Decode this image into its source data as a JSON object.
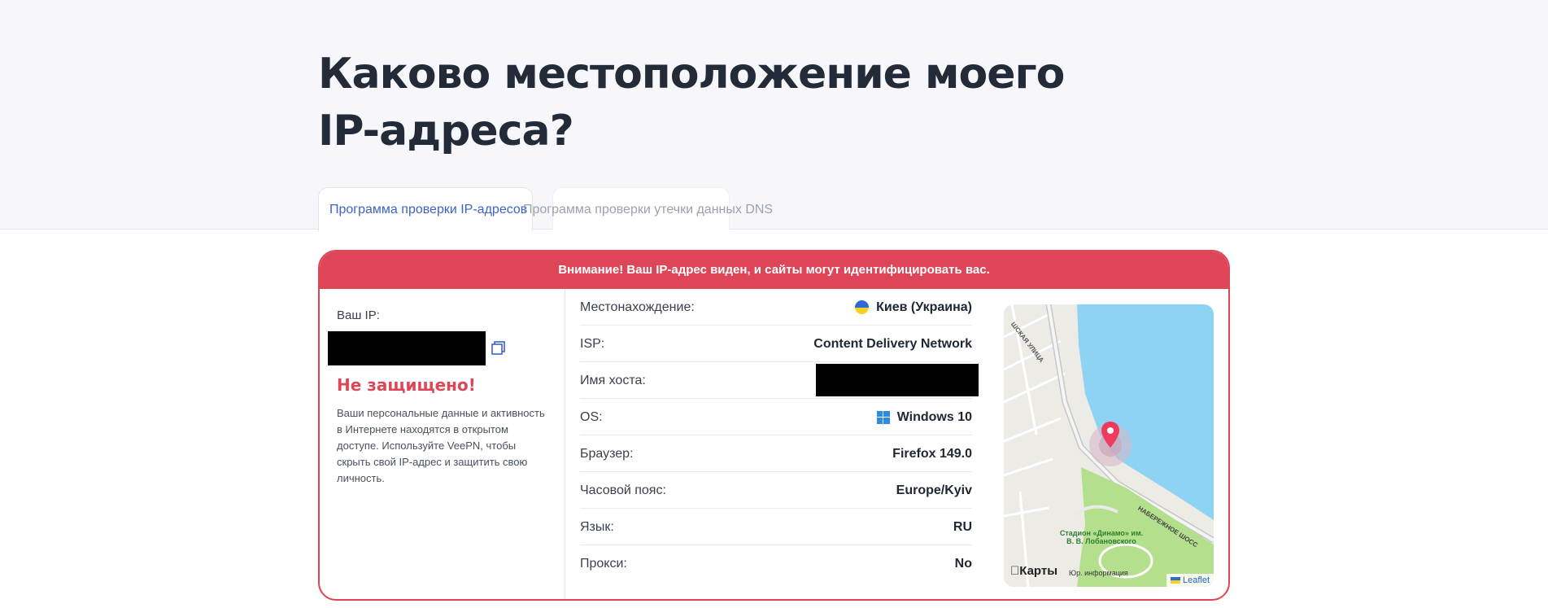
{
  "title": "Каково местоположение моего IP-адреса?",
  "tabs": [
    {
      "label": "Программа проверки IP-адресов",
      "active": true
    },
    {
      "label": "Программа проверки утечки данных DNS",
      "active": false
    }
  ],
  "warning": "Внимание! Ваш IP-адрес виден, и сайты могут идентифицировать вас.",
  "ip_panel": {
    "label": "Ваш IP:",
    "status": "Не защищено!",
    "description": "Ваши персональные данные и активность в Интернете находятся в открытом доступе. Используйте VeePN, чтобы скрыть свой IP-адрес и защитить свою личность."
  },
  "info_rows": [
    {
      "label": "Местонахождение:",
      "value": "Киев (Украина)"
    },
    {
      "label": "ISP:",
      "value": "Content Delivery Network"
    },
    {
      "label": "Имя хоста:",
      "value": ""
    },
    {
      "label": "OS:",
      "value": "Windows 10"
    },
    {
      "label": "Браузер:",
      "value": "Firefox 149.0"
    },
    {
      "label": "Часовой пояс:",
      "value": "Europe/Kyiv"
    },
    {
      "label": "Язык:",
      "value": "RU"
    },
    {
      "label": "Прокси:",
      "value": "No"
    }
  ],
  "map": {
    "street_label": "ШСКАЯ УЛИЦА",
    "embankment_label": "НАБЕРЕЖНОЕ ШОСС",
    "stadium_label": "Стадион «Динамо» им. В. В. Лобановского",
    "brand": "Карты",
    "legal": "Юр. информация",
    "attribution": "Leaflet"
  },
  "colors": {
    "accent_red": "#de4658",
    "tab_active": "#3d63c9",
    "water": "#8ed3f3",
    "park": "#b4e08e"
  }
}
